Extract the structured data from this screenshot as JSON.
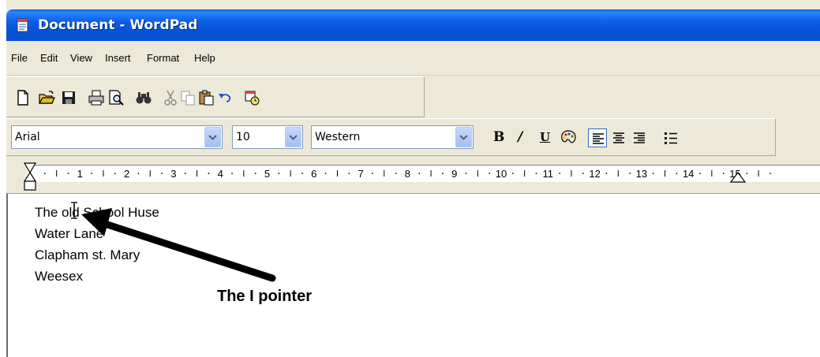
{
  "window": {
    "title": "Document - WordPad"
  },
  "menu": [
    "File",
    "Edit",
    "View",
    "Insert",
    "Format",
    "Help"
  ],
  "toolbar": {
    "icons": [
      "new-icon",
      "open-icon",
      "save-icon",
      "print-icon",
      "print-preview-icon",
      "find-icon",
      "cut-icon",
      "copy-icon",
      "paste-icon",
      "undo-icon",
      "date-time-icon"
    ]
  },
  "formatbar": {
    "font": "Arial",
    "size": "10",
    "script": "Western",
    "bold": "B",
    "italic": "/",
    "underline": "U"
  },
  "ruler": {
    "labels": [
      "1",
      "2",
      "3",
      "4",
      "5",
      "6",
      "7",
      "8",
      "9",
      "10",
      "11",
      "12",
      "13",
      "14",
      "15"
    ]
  },
  "document": {
    "lines": [
      "The old School Huse",
      "Water Lane",
      "Clapham st. Mary",
      "Weesex"
    ]
  },
  "annotation": {
    "label": "The I pointer"
  },
  "colors": {
    "title_bar": "#0a5fe0",
    "chrome": "#ece9d8",
    "accent": "#316ac5"
  }
}
